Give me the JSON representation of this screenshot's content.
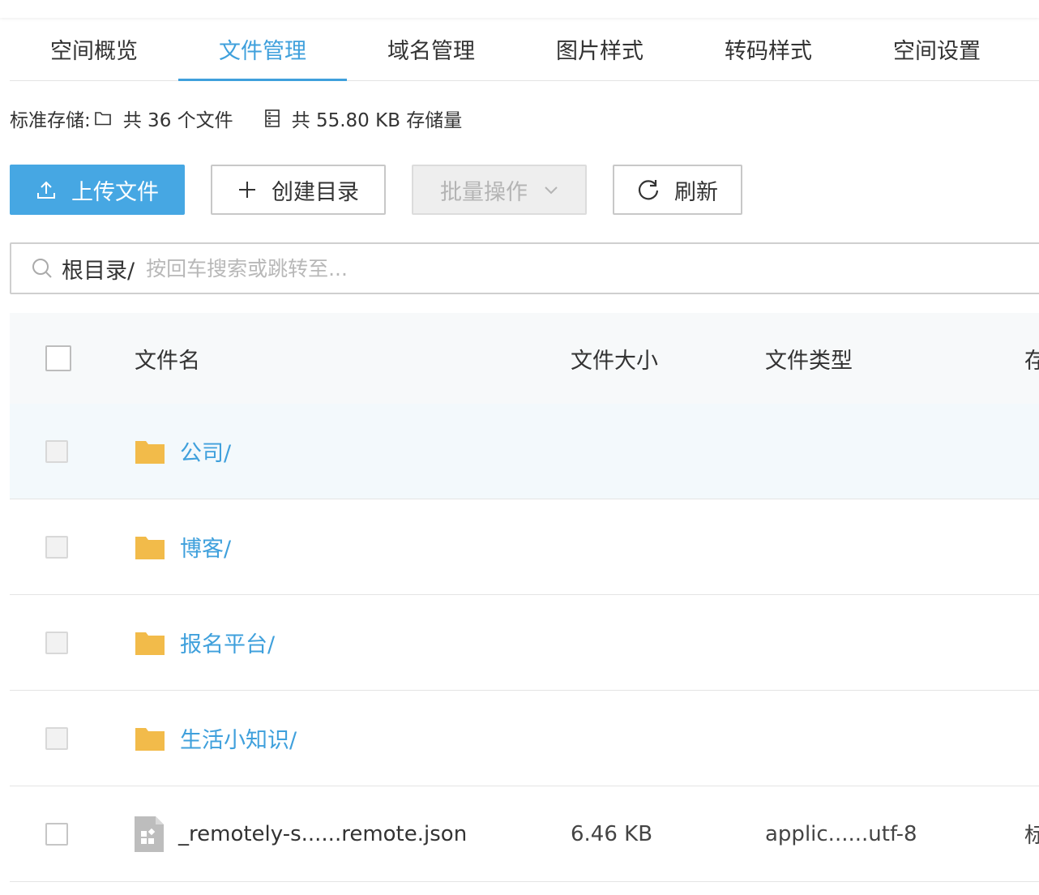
{
  "tabs": [
    {
      "label": "空间概览",
      "active": false
    },
    {
      "label": "文件管理",
      "active": true
    },
    {
      "label": "域名管理",
      "active": false
    },
    {
      "label": "图片样式",
      "active": false
    },
    {
      "label": "转码样式",
      "active": false
    },
    {
      "label": "空间设置",
      "active": false
    }
  ],
  "stats": {
    "label": "标准存储:",
    "files_text": "共 36 个文件",
    "storage_text": "共 55.80 KB 存储量"
  },
  "toolbar": {
    "upload_label": "上传文件",
    "mkdir_label": "创建目录",
    "batch_label": "批量操作",
    "refresh_label": "刷新"
  },
  "search": {
    "path": "根目录/",
    "placeholder": "按回车搜索或跳转至..."
  },
  "table": {
    "headers": {
      "name": "文件名",
      "size": "文件大小",
      "type": "文件类型",
      "storage": "存"
    },
    "folders": [
      {
        "name": "公司/"
      },
      {
        "name": "博客/"
      },
      {
        "name": "报名平台/"
      },
      {
        "name": "生活小知识/"
      }
    ],
    "files": [
      {
        "name": "_remotely-s......remote.json",
        "size": "6.46 KB",
        "type": "applic......utf-8",
        "storage": "标"
      }
    ]
  },
  "colors": {
    "accent": "#3fa0dc",
    "upload_button": "#46a7e3",
    "folder": "#f2bb4a",
    "row_hover": "#f3f9fc"
  }
}
